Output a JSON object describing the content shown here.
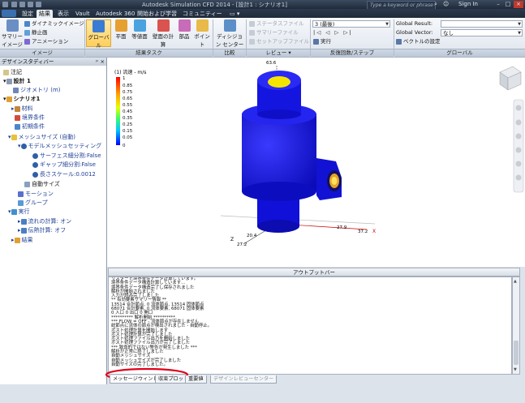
{
  "titlebar": {
    "title": "Autodesk Simulation CFD 2014 - [設計1 : シナリオ1]",
    "search_placeholder": "Type a keyword or phrase",
    "sign_in": "Sign In"
  },
  "menu": {
    "tabs": [
      "設定",
      "結果",
      "表示",
      "Vault",
      "Autodesk 360",
      "開始および学習",
      "コミュニティー"
    ],
    "active": "結果",
    "extra": "▭ ▾"
  },
  "ribbon": {
    "image_group": {
      "label": "イメージ",
      "save_image": "サマリー イメージ",
      "dynamic_image": "ダイナミックイメージ",
      "still_image": "静止画",
      "animation": "アニメーション"
    },
    "result_tasks": {
      "label": "結果タスク",
      "buttons": [
        "グローバル",
        "平面",
        "等値面",
        "壁面の計算",
        "部品",
        "ポイント"
      ],
      "selected": "グローバル"
    },
    "compare": {
      "label": "比較",
      "button": "ディシジョン センター"
    },
    "review": {
      "label": "レビュー ▾",
      "items": [
        "ステータスファイル",
        "サマリーファイル",
        "セットアップファイル"
      ]
    },
    "steps": {
      "label": "反復回数/ステップ",
      "combo": "3 (最後)",
      "run": "実行"
    },
    "global": {
      "label": "グローバル",
      "result_label": "Global Result:",
      "result_value": "",
      "vector_label": "Global Vector:",
      "vector_value": "なし",
      "vector_settings": "ベクトルの設定"
    }
  },
  "panel": {
    "title": "デザインスタディバー",
    "items": [
      {
        "label": "注記",
        "indent": 0
      },
      {
        "label": "設計 1",
        "indent": 0,
        "bold": true
      },
      {
        "label": "ジオメトリ (m)",
        "indent": 1
      },
      {
        "label": "シナリオ1",
        "indent": 0,
        "bold": true
      },
      {
        "label": "材料",
        "indent": 1
      },
      {
        "label": "境界条件",
        "indent": 1
      },
      {
        "label": "初期条件",
        "indent": 1
      },
      {
        "label": "メッシュサイズ (自動)",
        "indent": 1
      },
      {
        "label": "モデルメッシュセッティング",
        "indent": 2
      },
      {
        "label": "サーフェス細分割:False",
        "indent": 3
      },
      {
        "label": "ギャップ細分割:False",
        "indent": 3
      },
      {
        "label": "長さスケール:0.0012",
        "indent": 3
      },
      {
        "label": "自動サイズ",
        "indent": 2
      },
      {
        "label": "モーション",
        "indent": 1
      },
      {
        "label": "グループ",
        "indent": 1
      },
      {
        "label": "実行",
        "indent": 1
      },
      {
        "label": "流れの計算: オン",
        "indent": 2
      },
      {
        "label": "伝熱計算: オフ",
        "indent": 2
      },
      {
        "label": "結果",
        "indent": 1
      }
    ]
  },
  "legend": {
    "title": "(1) 流速 - m/s",
    "ticks": [
      "1",
      "0.85",
      "0.75",
      "0.65",
      "0.55",
      "0.45",
      "0.35",
      "0.25",
      "0.15",
      "0.05",
      "0"
    ]
  },
  "axes_labels": {
    "top": "63.6",
    "x1": "27.9",
    "x2": "37.2",
    "x_letter": "X",
    "z1": "20.4",
    "z2": "27.2",
    "z_letter": "Z"
  },
  "output": {
    "title": "アウトプットバー",
    "lines": [
      "リスタート境界条件データ計算しています。",
      "境界条件データ構造計算しています...",
      "境界条件データ構造完了し保存されました",
      "解析が開始されました",
      "入力が読み完了しました",
      "** 有効要素サマリー情報 **",
      "  13514 合計節点, 0 流体節点,  13514 固体節点",
      "  68071 合計要素, 0 流体要素,  68071 固体要素",
      "  0 入口  0 出口  0 開口",
      "********** 解析開始 **********",
      "*** FLOW = OFF - 流体節点が存在しません",
      "総節点に流体の節点が検出されました - 自動停止。",
      "ポスト処理計算を開始します",
      "ポスト処理計算が完了しました",
      "ポスト処理ファイル出力を開始しました",
      "ポスト処理ファイル出力が完了しました",
      "*** 致命的ではない警告が発生しました ***",
      "解析が正常に終了しました",
      "自動メッシュサイズ",
      "自動メッシュサイズが完了しました",
      "自動サイズの完了しました。"
    ]
  },
  "bottom_tabs": [
    "メッセージウィンドウ",
    "収束プロット",
    "重要値",
    "デザインレビューセンター"
  ],
  "colors": {
    "model_blue": "#1414e6",
    "inlet_face": "#f5e400",
    "annotation_red": "#e0001a"
  }
}
